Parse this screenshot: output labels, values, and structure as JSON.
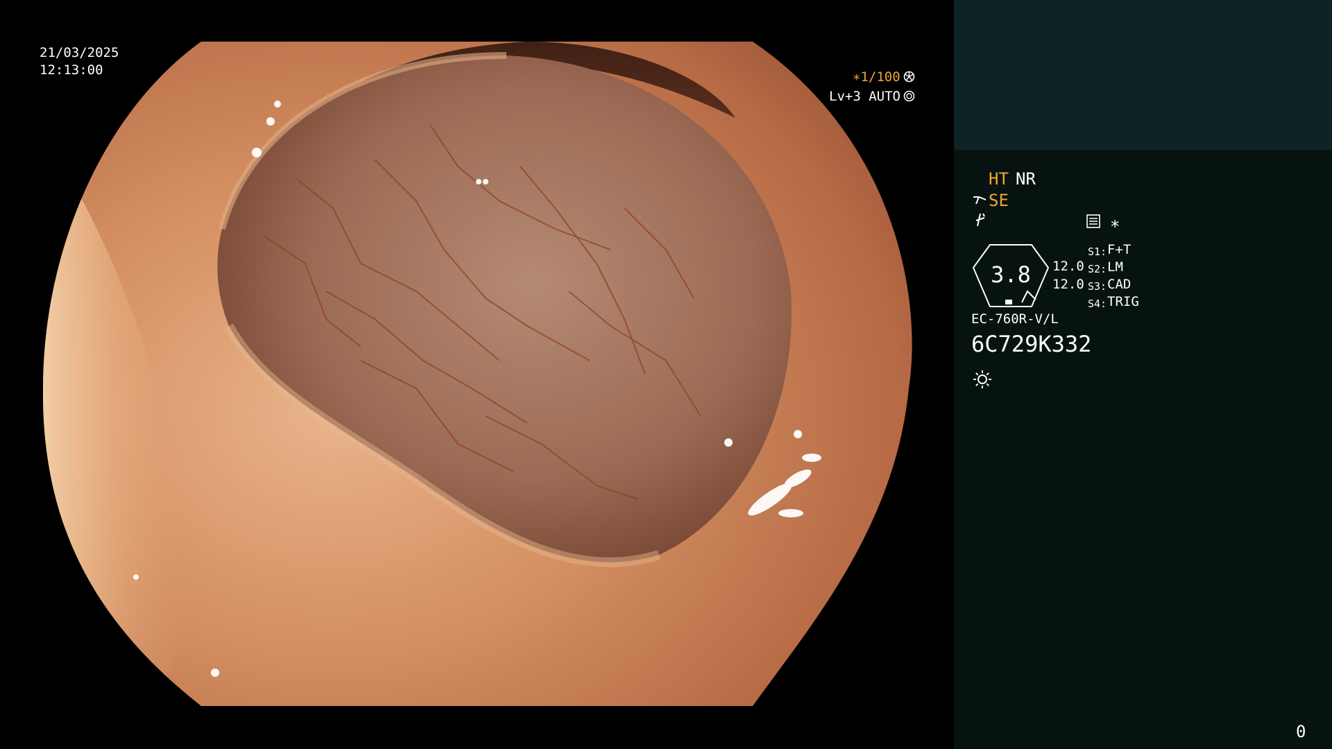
{
  "overlay": {
    "date": "21/03/2025",
    "time": "12:13:00",
    "shutter": "∗1/100",
    "iris_level": "Lv+3 AUTO"
  },
  "panel": {
    "mode_ht": "HT",
    "mode_nr": "NR",
    "mode_se": "SE",
    "asterisk": "∗",
    "zoom_value": "3.8",
    "val_a": "12.0",
    "val_b": "12.0",
    "switches": [
      {
        "key": "S1:",
        "value": "F+T"
      },
      {
        "key": "S2:",
        "value": "LM"
      },
      {
        "key": "S3:",
        "value": "CAD"
      },
      {
        "key": "S4:",
        "value": "TRIG"
      }
    ],
    "scope_model": "EC-760R-V/L",
    "serial": "6C729K332",
    "counter": "0"
  },
  "colors": {
    "accent_yellow": "#f2a531",
    "panel_bg": "#071311",
    "panel_top_bg": "#0d2324"
  },
  "icons": [
    "shutter-icon",
    "auto-iris-icon",
    "scope-tip-icon",
    "pump-icon",
    "settings-list-icon",
    "brightness-icon"
  ]
}
